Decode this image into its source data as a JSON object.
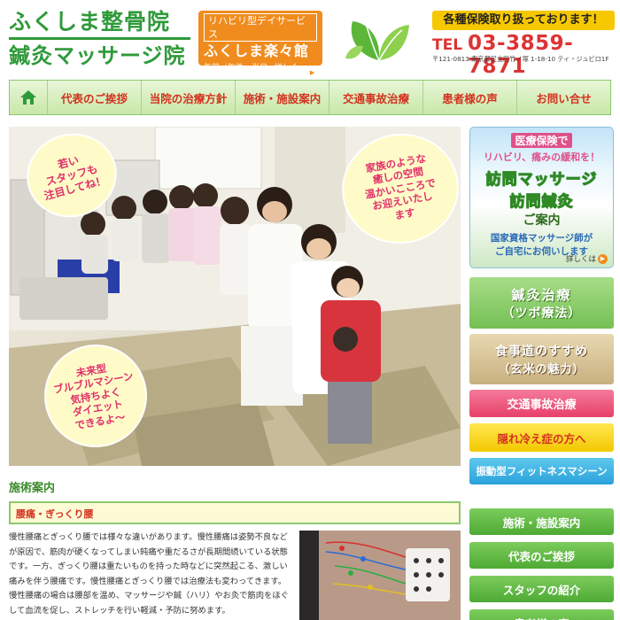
{
  "header": {
    "logo_line1": "ふくしま整骨院",
    "logo_line2": "鍼灸マッサージ院",
    "dayservice": {
      "top": "リハビリ型デイサービス",
      "name": "ふくしま楽々館",
      "hours": "午前／午後　半日制",
      "detail": "詳しくは"
    },
    "insurance": "各種保険取り扱っております！",
    "tel_label": "TEL",
    "tel_number": "03-3859-7871",
    "address": "〒121-0813 東京都足立区竹ノ塚 1-18-10 ティ・ジュビロ1F"
  },
  "nav": {
    "home_icon": "home-icon",
    "items": [
      {
        "label": "代表のご挨拶"
      },
      {
        "label": "当院の治療方針"
      },
      {
        "label": "施術・施設案内"
      },
      {
        "label": "交通事故治療"
      },
      {
        "label": "患者様の声"
      },
      {
        "label": "お問い合せ"
      }
    ]
  },
  "hero": {
    "bubble1": "若い\nスタッフも\n注目してね！",
    "bubble2": "家族のような\n癒しの空間\n温かいこころで\nお迎えいたし\nます",
    "bubble3": "未来型\nブルブルマシーン\n気持ちよく\nダイエット\nできるよ～"
  },
  "content": {
    "section_title": "施術案内",
    "sub_heading": "腰痛・ぎっくり腰",
    "body_text": "慢性腰痛とぎっくり腰では様々な違いがあります。慢性腰痛は姿勢不良などが原因で、筋肉が硬くなってしまい鈍痛や重だるさが長期間続いている状態です。一方、ぎっくり腰は重たいものを持った時などに突然起こる、激しい痛みを伴う腰痛です。慢性腰痛とぎっくり腰では治療法も変わってきます。慢性腰痛の場合は腰部を温め、マッサージや鍼（ハリ）やお灸で筋肉をほぐして血流を促し、ストレッチを行い軽減・予防に努めます。"
  },
  "sidebar": {
    "visit": {
      "line1": "医療保険で",
      "line2": "リハビリ、痛みの緩和を！",
      "title1": "訪問マッサージ",
      "title2": "訪問鍼灸",
      "title3": "ご案内",
      "line3": "国家資格マッサージ師が",
      "line4": "ご自宅にお伺いします",
      "detail": "詳しくは"
    },
    "acu_title": "鍼灸治療",
    "acu_sub": "（ツボ療法）",
    "food_title": "食事道のすすめ",
    "food_sub": "（玄米の魅力）",
    "traffic": "交通事故治療",
    "cold": "隠れ冷え症の方へ",
    "vibration": "振動型フィットネスマシーン",
    "links": [
      {
        "label": "施術・施設案内"
      },
      {
        "label": "代表のご挨拶"
      },
      {
        "label": "スタッフの紹介"
      },
      {
        "label": "患者様の声"
      }
    ]
  }
}
